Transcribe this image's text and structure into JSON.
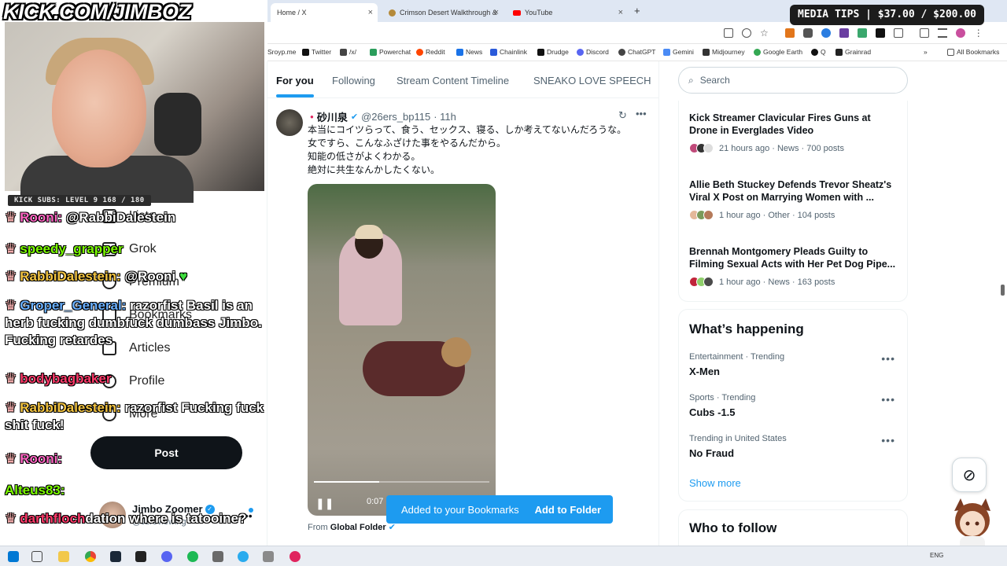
{
  "browser": {
    "tabs": [
      {
        "label": "Home / X",
        "active": true
      },
      {
        "label": "Crimson Desert Walkthrough &",
        "active": false
      },
      {
        "label": "YouTube",
        "active": false
      }
    ],
    "new_tab": "+",
    "bookmarks": [
      "Sroyp.me",
      "Twitter",
      "/x/",
      "Powerchat",
      "Reddit",
      "News",
      "Chainlink",
      "Drudge",
      "Discord",
      "ChatGPT",
      "Gemini",
      "Midjourney",
      "Google Earth",
      "Q",
      "Grainrad"
    ],
    "all_bookmarks": "All Bookmarks"
  },
  "overlay": {
    "kick_url": "KICK.COM/JIMBOZ",
    "subs": "KICK SUBS: LEVEL 9 168 / 180",
    "media_tips": "MEDIA TIPS | $37.00 / $200.00"
  },
  "chat": [
    {
      "user": "Rooni:",
      "text": "@RabbiDalestein",
      "color": "#ff66c4"
    },
    {
      "user": "speedy_grapper",
      "text": "",
      "color": "#7cfc00"
    },
    {
      "user": "RabbiDalestein:",
      "text": "@Rooni",
      "color": "#f4c542"
    },
    {
      "user": "Groper_General:",
      "text": "razorfist Basil is an herb fucking dumbfuck dumbass Jimbo. Fucking retardes",
      "color": "#6ab0ff"
    },
    {
      "user": "bodybagbaker",
      "text": "",
      "color": "#ff3b6b"
    },
    {
      "user": "RabbiDalestein:",
      "text": "razorfist Fucking fuck shit fuck!",
      "color": "#f4c542"
    },
    {
      "user": "Rooni:",
      "text": "",
      "color": "#ff66c4"
    },
    {
      "user": "Alteus83:",
      "text": "",
      "color": "#7cfc00"
    },
    {
      "user": "darthfloch",
      "text": "dation where is tatooine?",
      "color": "#ff3b6b"
    }
  ],
  "nav": {
    "items": [
      "Lists",
      "Grok",
      "Premium",
      "Bookmarks",
      "Articles",
      "Profile",
      "More"
    ],
    "post": "Post",
    "account_name": "Jimbo Zoomer",
    "account_handle": "@Jzreviewing"
  },
  "feed": {
    "tabs": [
      "For you",
      "Following",
      "Stream Content Timeline",
      "SNEAKO LOVE SPEECH"
    ],
    "tweet": {
      "name": "砂川泉",
      "handle": "@26ers_bp115",
      "time": "· 11h",
      "lines": [
        "本当にコイツらって、食う、セックス、寝る、しか考えてないんだろうな。",
        "女ですら、こんなふざけた事をやるんだから。",
        "知能の低さがよくわかる。",
        "絶対に共生なんかしたくない。"
      ],
      "video_time": "0:07",
      "video_progress": 0.37,
      "from_label": "From",
      "from_source": "Global Folder"
    },
    "toast": {
      "text": "Added to your Bookmarks",
      "action": "Add to Folder"
    }
  },
  "sidebar": {
    "search_placeholder": "Search",
    "news": [
      {
        "title": "Kick Streamer Clavicular Fires Guns at Drone in Everglades Video",
        "meta": "21 hours ago · News · 700 posts"
      },
      {
        "title": "Allie Beth Stuckey Defends Trevor Sheatz's Viral X Post on Marrying Women with ...",
        "meta": "1 hour ago · Other · 104 posts"
      },
      {
        "title": "Brennah Montgomery Pleads Guilty to Filming Sexual Acts with Her Pet Dog Pipe...",
        "meta": "1 hour ago · News · 163 posts"
      }
    ],
    "happening_title": "What’s happening",
    "trends": [
      {
        "context": "Entertainment · Trending",
        "name": "X-Men"
      },
      {
        "context": "Sports · Trending",
        "name": "Cubs -1.5"
      },
      {
        "context": "Trending in United States",
        "name": "No Fraud"
      }
    ],
    "show_more": "Show more",
    "who_to_follow": "Who to follow"
  },
  "taskbar": {
    "lang": "ENG"
  }
}
